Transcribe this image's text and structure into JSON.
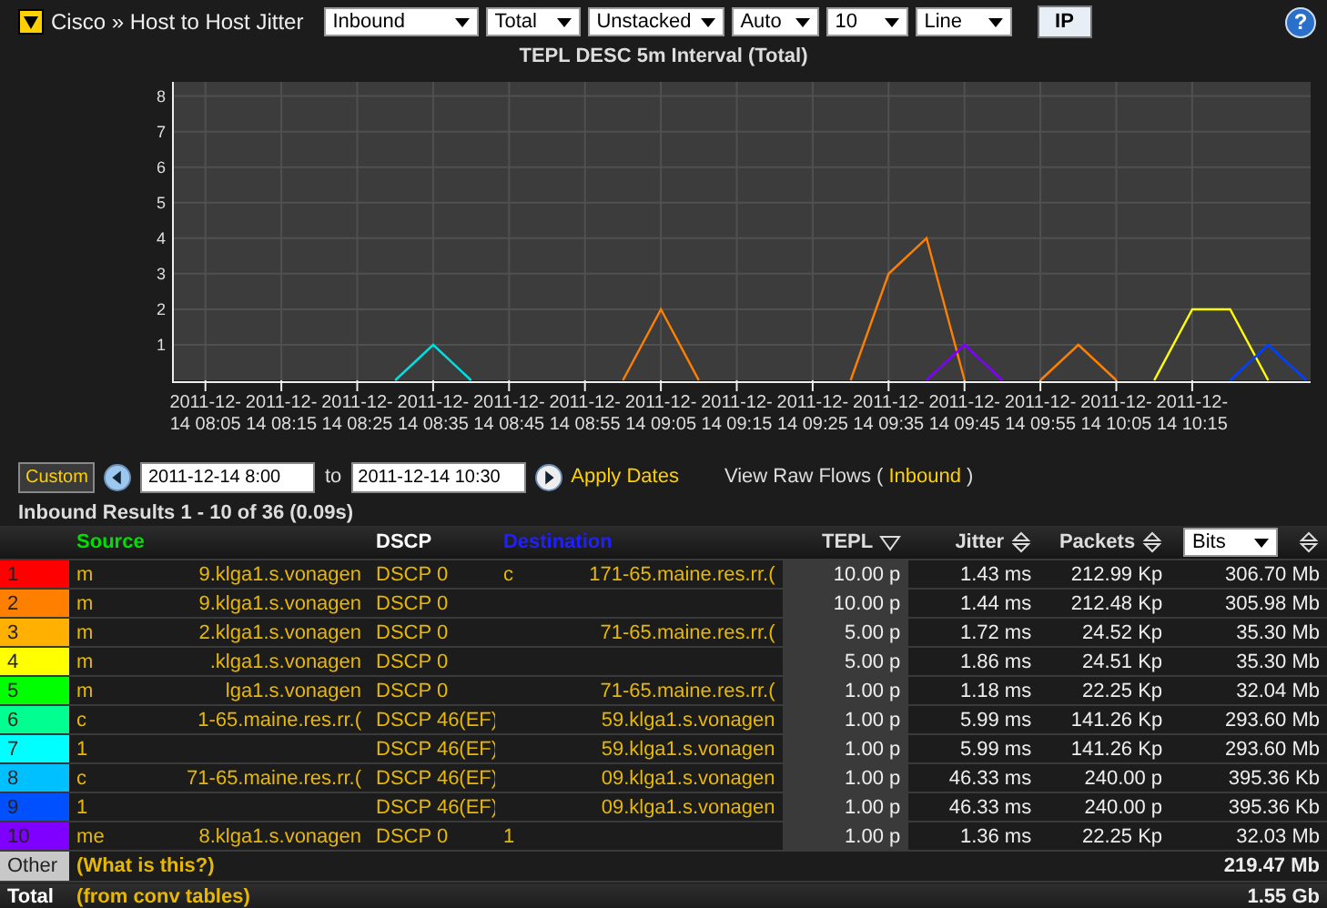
{
  "toolbar": {
    "breadcrumb": "Cisco » Host to Host Jitter",
    "dropdowns": [
      "Inbound",
      "Total",
      "Unstacked",
      "Auto",
      "10",
      "Line"
    ],
    "ip_button": "IP",
    "help": "?"
  },
  "chart": {
    "chart_data": {
      "type": "line",
      "title": "TEPL DESC 5m Interval (Total)",
      "grid": true,
      "categories": [
        null,
        "2011-12-14 08:05",
        null,
        "2011-12-14 08:15",
        null,
        "2011-12-14 08:25",
        null,
        "2011-12-14 08:35",
        null,
        "2011-12-14 08:45",
        null,
        "2011-12-14 08:55",
        null,
        "2011-12-14 09:05",
        null,
        "2011-12-14 09:15",
        null,
        "2011-12-14 09:25",
        null,
        "2011-12-14 09:35",
        null,
        "2011-12-14 09:45",
        null,
        "2011-12-14 09:55",
        null,
        "2011-12-14 10:05",
        null,
        "2011-12-14 10:15",
        null,
        null,
        null
      ],
      "series": [
        {
          "color": "#00e0e0",
          "values": [
            null,
            null,
            null,
            null,
            null,
            null,
            0,
            1,
            0,
            null,
            null,
            null,
            null,
            null,
            null,
            null,
            null,
            null,
            null,
            null,
            null,
            null,
            null,
            null,
            null,
            null,
            null,
            null,
            null,
            null,
            null
          ]
        },
        {
          "color": "#ff8000",
          "values": [
            null,
            null,
            null,
            null,
            null,
            null,
            null,
            null,
            null,
            null,
            null,
            null,
            0,
            2,
            0,
            null,
            null,
            null,
            0,
            3,
            4,
            0,
            null,
            0,
            1,
            0,
            null,
            null,
            null,
            null,
            null
          ]
        },
        {
          "color": "#8000ff",
          "values": [
            null,
            null,
            null,
            null,
            null,
            null,
            null,
            null,
            null,
            null,
            null,
            null,
            null,
            null,
            null,
            null,
            null,
            null,
            null,
            null,
            0,
            1,
            0,
            null,
            null,
            null,
            null,
            null,
            null,
            null,
            null
          ]
        },
        {
          "color": "#ffff00",
          "values": [
            null,
            null,
            null,
            null,
            null,
            null,
            null,
            null,
            null,
            null,
            null,
            null,
            null,
            null,
            null,
            null,
            null,
            null,
            null,
            null,
            null,
            null,
            null,
            null,
            null,
            null,
            0,
            2,
            2,
            0,
            null
          ]
        },
        {
          "color": "#0040ff",
          "values": [
            null,
            null,
            null,
            null,
            null,
            null,
            null,
            null,
            null,
            null,
            null,
            null,
            null,
            null,
            null,
            null,
            null,
            null,
            null,
            null,
            null,
            null,
            null,
            null,
            null,
            null,
            null,
            null,
            0,
            1,
            0
          ]
        }
      ],
      "ylim": [
        0,
        8.4
      ],
      "yticks": [
        1,
        2,
        3,
        4,
        5,
        6,
        7,
        8
      ]
    }
  },
  "date_controls": {
    "custom_button": "Custom",
    "from": "2011-12-14 8:00",
    "to_label": "to",
    "to": "2011-12-14 10:30",
    "apply": "Apply Dates",
    "raw_flows": "View Raw Flows (",
    "raw_flows_link": "Inbound",
    "raw_flows_end": ")"
  },
  "results_title": "Inbound Results 1 - 10 of 36 (0.09s)",
  "table": {
    "columns": [
      {
        "label": "Source",
        "color": "#00e000"
      },
      {
        "label": "DSCP",
        "color": "#ffffff"
      },
      {
        "label": "Destination",
        "color": "#2020ff"
      },
      {
        "label": "TEPL"
      },
      {
        "label": "Jitter"
      },
      {
        "label": "Packets"
      },
      {
        "label": "Bits"
      }
    ],
    "rows": [
      {
        "number": "1",
        "color": "#ff0000",
        "source": {
          "start": "m",
          "end": "9.klga1.s.vonagen"
        },
        "dscp": "DSCP 0",
        "destination": {
          "start": "c",
          "end": "171-65.maine.res.rr.("
        },
        "tepl": "10.00 p",
        "jitter": "1.43 ms",
        "packets": "212.99 Kp",
        "bits": "306.70 Mb"
      },
      {
        "number": "2",
        "color": "#ff8000",
        "source": {
          "start": "m",
          "end": "9.klga1.s.vonagen"
        },
        "dscp": "DSCP 0",
        "tepl": "10.00 p",
        "jitter": "1.44 ms",
        "packets": "212.48 Kp",
        "bits": "305.98 Mb"
      },
      {
        "number": "3",
        "color": "#ffb000",
        "source": {
          "start": "m",
          "end": "2.klga1.s.vonagen"
        },
        "dscp": "DSCP 0",
        "destination": {
          "end": "71-65.maine.res.rr.("
        },
        "tepl": "5.00 p",
        "jitter": "1.72 ms",
        "packets": "24.52 Kp",
        "bits": "35.30 Mb"
      },
      {
        "number": "4",
        "color": "#ffff00",
        "source": {
          "start": "m",
          "end": ".klga1.s.vonagen"
        },
        "dscp": "DSCP 0",
        "tepl": "5.00 p",
        "jitter": "1.86 ms",
        "packets": "24.51 Kp",
        "bits": "35.30 Mb"
      },
      {
        "number": "5",
        "color": "#00ff00",
        "source": {
          "start": "m",
          "end": "lga1.s.vonagen"
        },
        "dscp": "DSCP 0",
        "destination": {
          "end": "71-65.maine.res.rr.("
        },
        "tepl": "1.00 p",
        "jitter": "1.18 ms",
        "packets": "22.25 Kp",
        "bits": "32.04 Mb"
      },
      {
        "number": "6",
        "color": "#00ff90",
        "source": {
          "start": "c",
          "end": "1-65.maine.res.rr.("
        },
        "dscp": "DSCP 46(EF)",
        "destination": {
          "end": "59.klga1.s.vonagen"
        },
        "tepl": "1.00 p",
        "jitter": "5.99 ms",
        "packets": "141.26 Kp",
        "bits": "293.60 Mb"
      },
      {
        "number": "7",
        "color": "#00ffff",
        "source": {
          "start": "1"
        },
        "dscp": "DSCP 46(EF)",
        "destination": {
          "end": "59.klga1.s.vonagen"
        },
        "tepl": "1.00 p",
        "jitter": "5.99 ms",
        "packets": "141.26 Kp",
        "bits": "293.60 Mb"
      },
      {
        "number": "8",
        "color": "#00c0ff",
        "source": {
          "start": "c",
          "end": "71-65.maine.res.rr.("
        },
        "dscp": "DSCP 46(EF)",
        "destination": {
          "end": "09.klga1.s.vonagen"
        },
        "tepl": "1.00 p",
        "jitter": "46.33 ms",
        "packets": "240.00 p",
        "bits": "395.36 Kb"
      },
      {
        "number": "9",
        "color": "#0050ff",
        "source": {
          "start": "1"
        },
        "dscp": "DSCP 46(EF)",
        "destination": {
          "end": "09.klga1.s.vonagen"
        },
        "tepl": "1.00 p",
        "jitter": "46.33 ms",
        "packets": "240.00 p",
        "bits": "395.36 Kb"
      },
      {
        "number": "10",
        "color": "#8000ff",
        "source": {
          "start": "me",
          "end": "8.klga1.s.vonagen"
        },
        "dscp": "DSCP 0",
        "destination": {
          "start": "1"
        },
        "tepl": "1.00 p",
        "jitter": "1.36 ms",
        "packets": "22.25 Kp",
        "bits": "32.03 Mb"
      }
    ],
    "other": {
      "label": "Other",
      "note": "(What is this?)",
      "bits": "219.47 Mb"
    },
    "total": {
      "label": "Total",
      "note": "(from conv tables)",
      "bits": "1.55 Gb"
    }
  }
}
